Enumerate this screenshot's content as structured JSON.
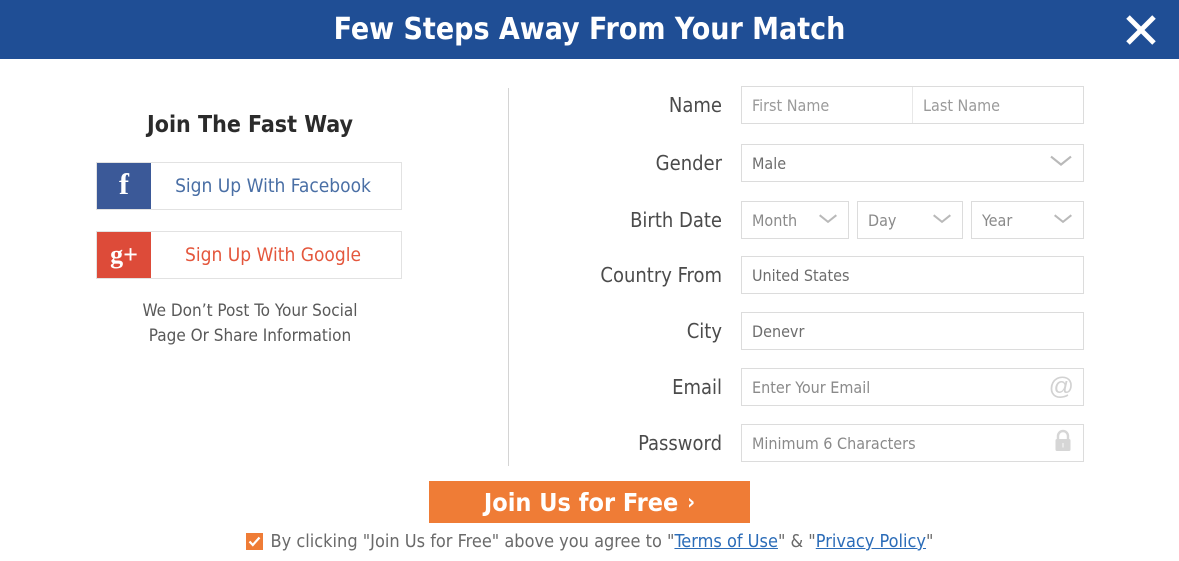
{
  "header": {
    "title": "Few Steps Away From Your Match",
    "close_label": "✕",
    "bg_color": "#1f4e95"
  },
  "left_panel": {
    "title": "Join The Fast Way",
    "facebook_button": {
      "icon": "facebook-f-icon",
      "icon_glyph": "f",
      "label": "Sign Up With Facebook",
      "icon_color": "#3b5998",
      "text_color": "#4a6fa5"
    },
    "google_button": {
      "icon": "google-plus-icon",
      "icon_glyph": "g+",
      "label": "Sign Up With Google",
      "icon_color": "#dd4b39",
      "text_color": "#e4573d"
    },
    "note_line1": "We Don’t Post To Your Social",
    "note_line2": "Page Or Share Information"
  },
  "form": {
    "name": {
      "label": "Name",
      "first_placeholder": "First Name",
      "first_value": "",
      "last_placeholder": "Last Name",
      "last_value": ""
    },
    "gender": {
      "label": "Gender",
      "value": "Male",
      "icon": "chevron-down-icon"
    },
    "birth_date": {
      "label": "Birth Date",
      "month_value": "Month",
      "day_value": "Day",
      "year_value": "Year",
      "icon": "chevron-down-icon"
    },
    "country": {
      "label": "Country From",
      "value": "United States",
      "placeholder": "Country From"
    },
    "city": {
      "label": "City",
      "value": "Denevr",
      "placeholder": "City"
    },
    "email": {
      "label": "Email",
      "value": "",
      "placeholder": "Enter Your Email",
      "icon": "at-sign-icon"
    },
    "password": {
      "label": "Password",
      "value": "",
      "placeholder": "Minimum 6 Characters",
      "icon": "lock-icon"
    }
  },
  "cta": {
    "label": "Join Us for Free",
    "chevron": "›",
    "color": "#ef7c36"
  },
  "terms": {
    "checkbox_checked": true,
    "text_before": "By clicking \"Join Us for Free\" above you agree to \"",
    "terms_link": "Terms of Use",
    "text_middle": "\" & \"",
    "privacy_link": "Privacy Policy",
    "text_after": "\"",
    "link_color": "#2b6cb8"
  }
}
